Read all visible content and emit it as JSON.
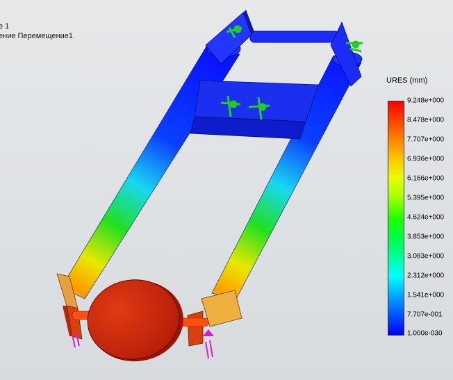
{
  "study": {
    "line1": "е 1",
    "line2": "ение Перемещение1"
  },
  "legend": {
    "title": "URES (mm)",
    "ticks": [
      "9.248e+000",
      "8.478e+000",
      "7.707e+000",
      "6.936e+000",
      "6.166e+000",
      "5.395e+000",
      "4.624e+000",
      "3.853e+000",
      "3.083e+000",
      "2.312e+000",
      "1.541e+000",
      "7.707e-001",
      "1.000e-030"
    ]
  },
  "colors": {
    "max": "#ff0000",
    "min": "#0000ff",
    "fixture": "#22cc22",
    "load": "#cc22cc"
  }
}
